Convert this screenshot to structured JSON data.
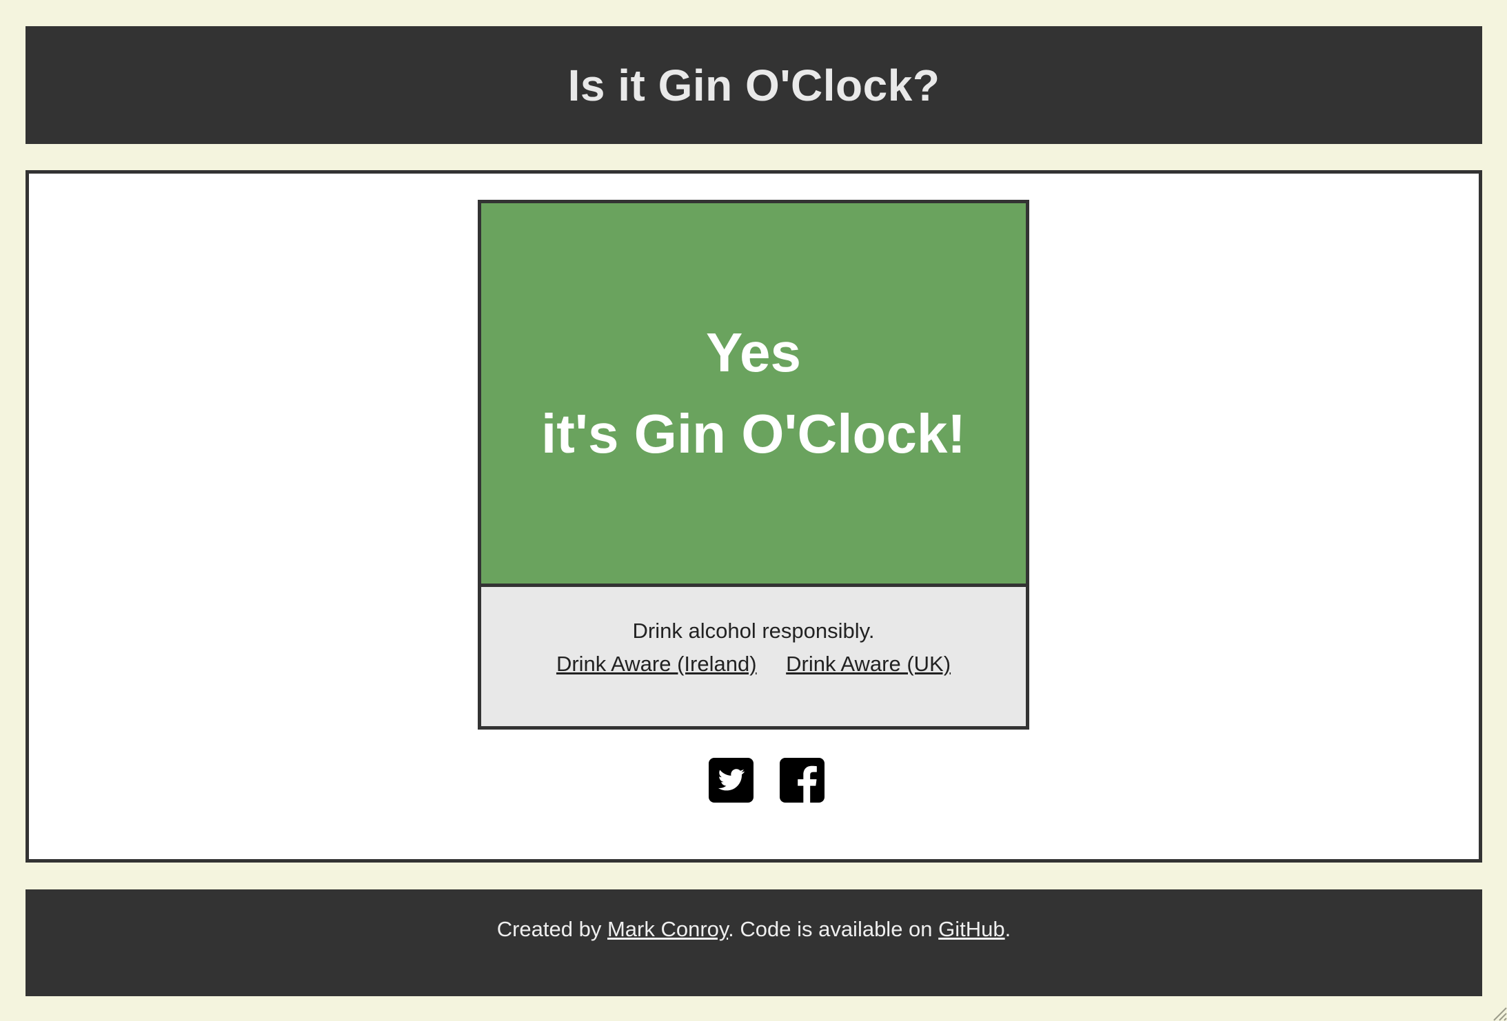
{
  "header": {
    "title": "Is it Gin O'Clock?"
  },
  "answer": {
    "line1": "Yes",
    "line2": "it's Gin O'Clock!",
    "color": "#6aa35e"
  },
  "responsibility": {
    "text": "Drink alcohol responsibly.",
    "links": [
      {
        "label": "Drink Aware (Ireland)"
      },
      {
        "label": "Drink Aware (UK)"
      }
    ]
  },
  "social": {
    "icons": [
      "twitter-icon",
      "facebook-icon"
    ]
  },
  "footer": {
    "prefix": "Created by ",
    "author_link": "Mark Conroy",
    "middle": ". Code is available on ",
    "code_link": "GitHub",
    "suffix": "."
  },
  "colors": {
    "page_background": "#f4f4de",
    "dark": "#333333",
    "panel": "#ffffff",
    "note_background": "#e8e8e8"
  }
}
